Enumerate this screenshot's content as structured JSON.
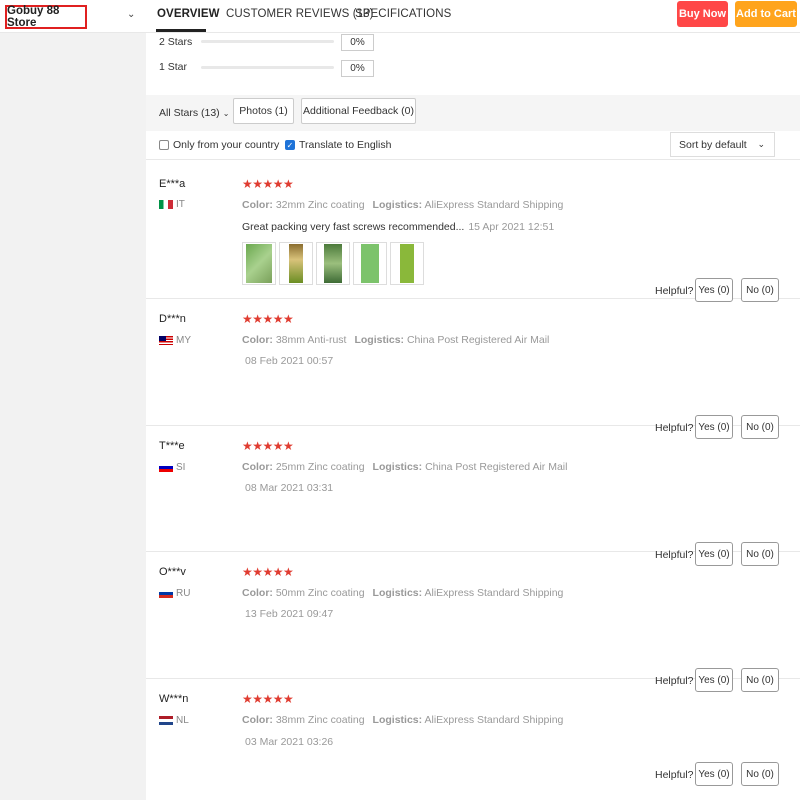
{
  "header": {
    "store_name": "Gobuy 88 Store",
    "tabs": [
      {
        "label": "OVERVIEW",
        "active": true
      },
      {
        "label": "CUSTOMER REVIEWS (13)",
        "active": false
      },
      {
        "label": "SPECIFICATIONS",
        "active": false
      }
    ],
    "buy_now": "Buy Now",
    "add_to_cart": "Add to Cart",
    "colors": {
      "buy_now": "#ff4747",
      "add_to_cart": "#ffa41c",
      "store_border": "#e02020"
    }
  },
  "rating_breakdown": [
    {
      "label": "2 Stars",
      "percent": "0%"
    },
    {
      "label": "1 Star",
      "percent": "0%"
    }
  ],
  "filters": {
    "all_stars": "All Stars (13)",
    "photos": "Photos (1)",
    "additional_feedback": "Additional Feedback (0)",
    "only_country": {
      "label": "Only from your country",
      "checked": false
    },
    "translate": {
      "label": "Translate to English",
      "checked": true
    },
    "sort": "Sort by default"
  },
  "reviews": [
    {
      "name": "E***a",
      "country": "IT",
      "flag": "italy-flag-icon",
      "stars": 5,
      "color_label": "Color:",
      "color": "32mm Zinc coating",
      "logistics_label": "Logistics:",
      "logistics": "AliExpress Standard Shipping",
      "text": "Great packing very fast screws recommended...",
      "date": "15 Apr 2021 12:51",
      "photos": 5,
      "helpful": "Helpful?",
      "yes": "Yes (0)",
      "no": "No (0)"
    },
    {
      "name": "D***n",
      "country": "MY",
      "flag": "malaysia-flag-icon",
      "stars": 5,
      "color_label": "Color:",
      "color": "38mm Anti-rust",
      "logistics_label": "Logistics:",
      "logistics": "China Post Registered Air Mail",
      "date": "08 Feb 2021 00:57",
      "helpful": "Helpful?",
      "yes": "Yes (0)",
      "no": "No (0)"
    },
    {
      "name": "T***e",
      "country": "SI",
      "flag": "slovenia-flag-icon",
      "stars": 5,
      "color_label": "Color:",
      "color": "25mm Zinc coating",
      "logistics_label": "Logistics:",
      "logistics": "China Post Registered Air Mail",
      "date": "08 Mar 2021 03:31",
      "helpful": "Helpful?",
      "yes": "Yes (0)",
      "no": "No (0)"
    },
    {
      "name": "O***v",
      "country": "RU",
      "flag": "russia-flag-icon",
      "stars": 5,
      "color_label": "Color:",
      "color": "50mm Zinc coating",
      "logistics_label": "Logistics:",
      "logistics": "AliExpress Standard Shipping",
      "date": "13 Feb 2021 09:47",
      "helpful": "Helpful?",
      "yes": "Yes (0)",
      "no": "No (0)"
    },
    {
      "name": "W***n",
      "country": "NL",
      "flag": "netherlands-flag-icon",
      "stars": 5,
      "color_label": "Color:",
      "color": "38mm Zinc coating",
      "logistics_label": "Logistics:",
      "logistics": "AliExpress Standard Shipping",
      "date": "03 Mar 2021 03:26",
      "helpful": "Helpful?",
      "yes": "Yes (0)",
      "no": "No (0)"
    }
  ],
  "star_color": "#e03c31"
}
